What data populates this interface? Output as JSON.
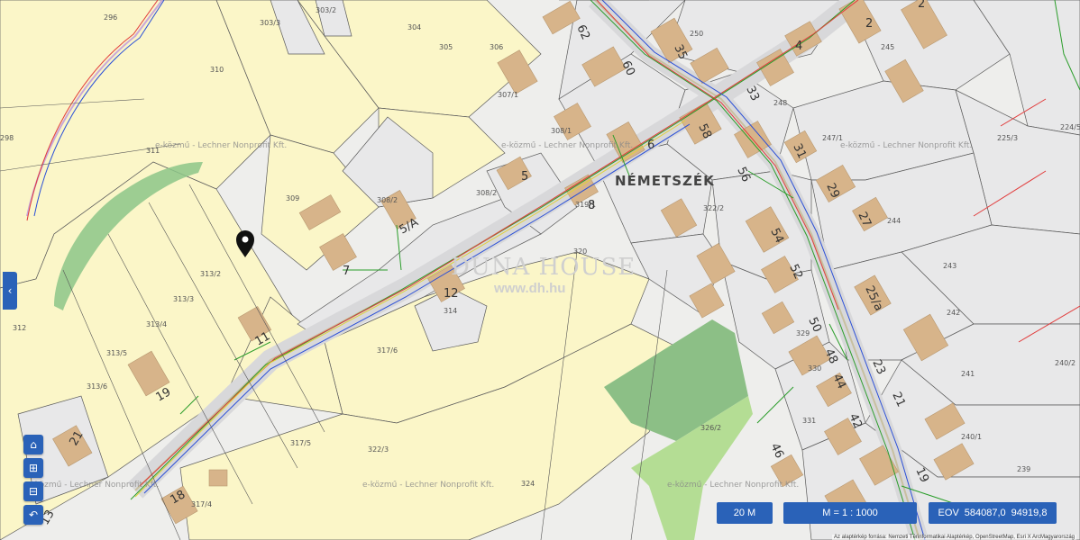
{
  "map": {
    "district_label": "NÉMETSZÉK",
    "watermark_parcel": "e-közmű - Lechner Nonprofit Kft.",
    "watermark_brand": "DUNA HOUSE",
    "watermark_url": "www.dh.hu",
    "parcel_numbers": [
      "296",
      "303/3",
      "303/2",
      "304",
      "305",
      "306",
      "307/1",
      "310",
      "311",
      "309",
      "308/2",
      "308/1",
      "308/2",
      "313/2",
      "313/3",
      "313/4",
      "313/5",
      "313/6",
      "312",
      "314",
      "317/6",
      "317/5",
      "317/4",
      "322/3",
      "320",
      "324",
      "326/2",
      "329",
      "331",
      "330",
      "322/2",
      "319/1",
      "250",
      "248",
      "245",
      "247/1",
      "225/3",
      "243",
      "242",
      "241",
      "240/2",
      "240/1",
      "239",
      "244",
      "298",
      "224/5"
    ],
    "house_numbers": [
      "62",
      "60",
      "58",
      "56",
      "54",
      "52",
      "50",
      "48",
      "46",
      "44",
      "42",
      "35",
      "33",
      "31",
      "29",
      "27",
      "25/a",
      "23",
      "21",
      "19",
      "6",
      "5",
      "8",
      "5/A",
      "7",
      "12",
      "11",
      "19",
      "18",
      "21",
      "2",
      "4",
      "2",
      "13"
    ]
  },
  "controls": {
    "side_tab_icon": "chevron-left-icon",
    "home_icon": "home-icon",
    "zoom_in_icon": "zoom-in-icon",
    "zoom_out_icon": "zoom-out-icon",
    "back_icon": "back-icon",
    "home_glyph": "⌂",
    "zoom_in_glyph": "⊞",
    "zoom_out_glyph": "⊟",
    "back_glyph": "↶",
    "side_glyph": "‹"
  },
  "status": {
    "distance": "20 M",
    "scale": "M = 1 : 1000",
    "coords_label": "EOV",
    "coords_x": "584087,0",
    "coords_y": "94919,8"
  },
  "attribution": "Az alaptérkép forrása: Nemzeti Térinformatikai Alaptérkép, OpenStreetMap, Esri X ArcMagyarország",
  "colors": {
    "accent": "#2a62b8",
    "yellow_parcel": "#fbf6c8",
    "grey_parcel": "#e9e9ea",
    "building": "#d7b48a",
    "green": "#8cc588"
  }
}
